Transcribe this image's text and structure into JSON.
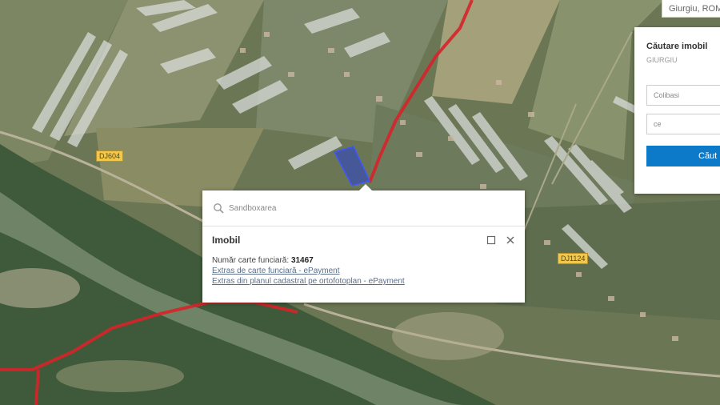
{
  "map": {
    "road_labels": [
      "DJ604",
      "DJ1124"
    ],
    "location_box": "Giurgiu, ROM"
  },
  "search_panel": {
    "title": "Căutare imobil",
    "county": "GIURGIU",
    "locality_field": "Colibasi",
    "number_field": "ce",
    "button_label": "Căut"
  },
  "popup": {
    "search_placeholder": "Sandboxarea",
    "title": "Imobil",
    "cf_label": "Număr carte funciară:",
    "cf_number": "31467",
    "link_extras_cf": "Extras de carte funciară - ePayment",
    "link_extras_plan": "Extras din planul cadastral pe ortofotoplan - ePayment"
  },
  "colors": {
    "boundary_red": "#d6242a",
    "parcel_blue": "#2a3fd0",
    "button_blue": "#0d79c9",
    "road_label_yellow": "#f2c84b"
  },
  "icons": [
    "search-icon",
    "maximize-icon",
    "close-icon"
  ]
}
